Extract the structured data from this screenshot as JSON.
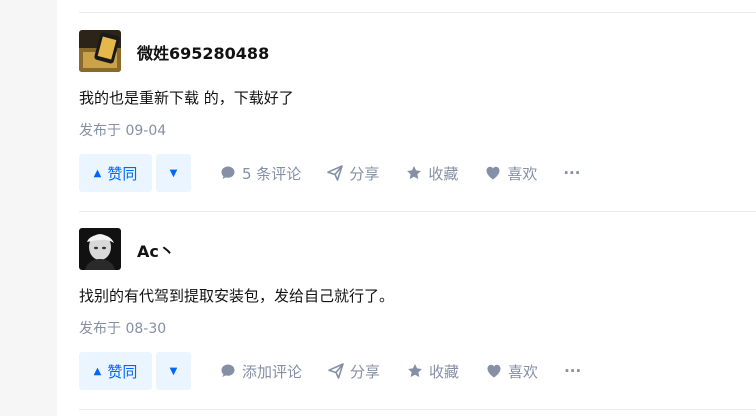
{
  "answers": [
    {
      "author": "微姓695280488",
      "content": "我的也是重新下载 的，下载好了",
      "date": "发布于 09-04",
      "upvote_label": "赞同",
      "comment_label": "5 条评论",
      "share_label": "分享",
      "collect_label": "收藏",
      "like_label": "喜欢",
      "more_label": "···"
    },
    {
      "author": "Ac丶",
      "content": "找别的有代驾到提取安装包，发给自己就行了。",
      "date": "发布于 08-30",
      "upvote_label": "赞同",
      "comment_label": "添加评论",
      "share_label": "分享",
      "collect_label": "收藏",
      "like_label": "喜欢",
      "more_label": "···"
    }
  ],
  "colors": {
    "accent": "#0066ff",
    "accent_bg": "#ebf5ff",
    "meta": "#8590a6"
  }
}
